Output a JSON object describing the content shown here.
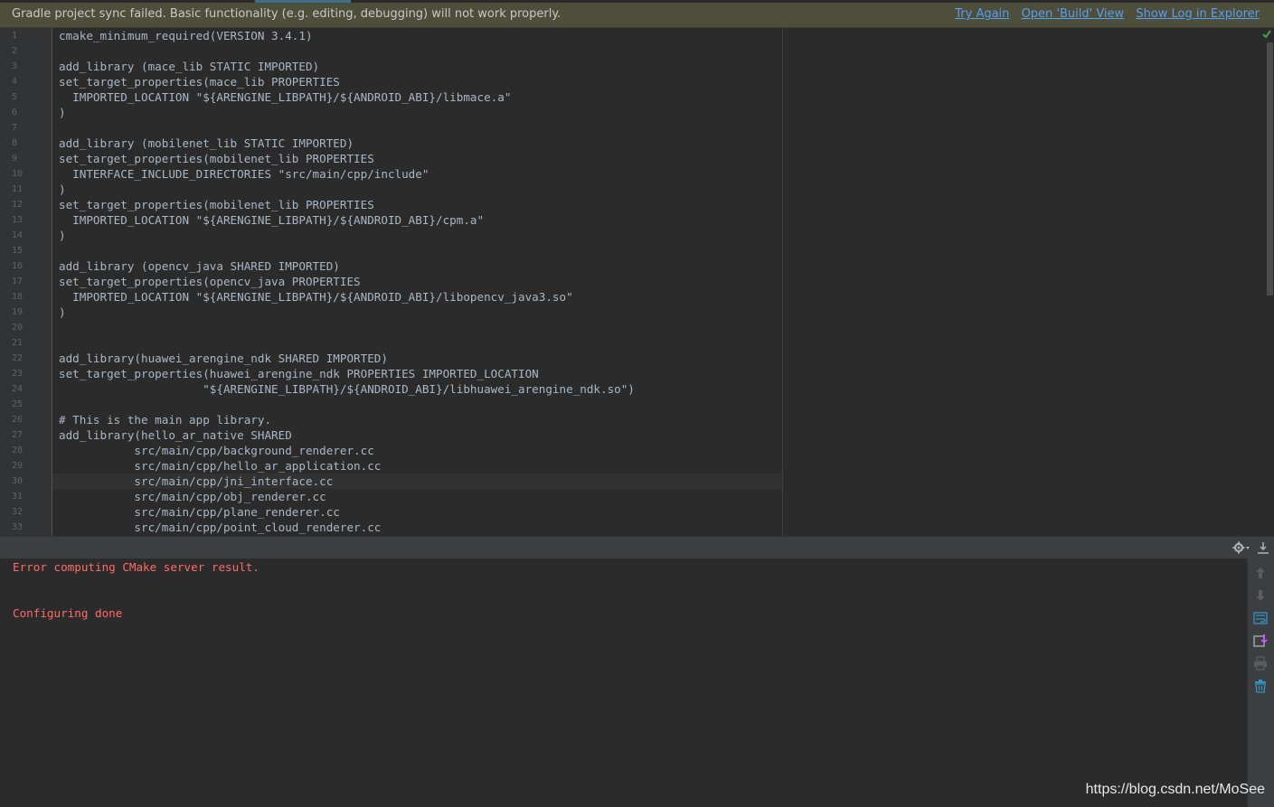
{
  "banner": {
    "message": "Gradle project sync failed. Basic functionality (e.g. editing, debugging) will not work properly.",
    "links": [
      "Try Again",
      "Open 'Build' View",
      "Show Log in Explorer"
    ]
  },
  "editor": {
    "highlighted_line": 30,
    "lines": [
      {
        "n": "1",
        "t": "cmake_minimum_required(VERSION 3.4.1)"
      },
      {
        "n": "2",
        "t": ""
      },
      {
        "n": "3",
        "t": "add_library (mace_lib STATIC IMPORTED)"
      },
      {
        "n": "4",
        "t": "set_target_properties(mace_lib PROPERTIES"
      },
      {
        "n": "5",
        "t": "  IMPORTED_LOCATION \"${ARENGINE_LIBPATH}/${ANDROID_ABI}/libmace.a\""
      },
      {
        "n": "6",
        "t": ")"
      },
      {
        "n": "7",
        "t": ""
      },
      {
        "n": "8",
        "t": "add_library (mobilenet_lib STATIC IMPORTED)"
      },
      {
        "n": "9",
        "t": "set_target_properties(mobilenet_lib PROPERTIES"
      },
      {
        "n": "10",
        "t": "  INTERFACE_INCLUDE_DIRECTORIES \"src/main/cpp/include\""
      },
      {
        "n": "11",
        "t": ")"
      },
      {
        "n": "12",
        "t": "set_target_properties(mobilenet_lib PROPERTIES"
      },
      {
        "n": "13",
        "t": "  IMPORTED_LOCATION \"${ARENGINE_LIBPATH}/${ANDROID_ABI}/cpm.a\""
      },
      {
        "n": "14",
        "t": ")"
      },
      {
        "n": "15",
        "t": ""
      },
      {
        "n": "16",
        "t": "add_library (opencv_java SHARED IMPORTED)"
      },
      {
        "n": "17",
        "t": "set_target_properties(opencv_java PROPERTIES"
      },
      {
        "n": "18",
        "t": "  IMPORTED_LOCATION \"${ARENGINE_LIBPATH}/${ANDROID_ABI}/libopencv_java3.so\""
      },
      {
        "n": "19",
        "t": ")"
      },
      {
        "n": "20",
        "t": ""
      },
      {
        "n": "21",
        "t": ""
      },
      {
        "n": "22",
        "t": "add_library(huawei_arengine_ndk SHARED IMPORTED)"
      },
      {
        "n": "23",
        "t": "set_target_properties(huawei_arengine_ndk PROPERTIES IMPORTED_LOCATION"
      },
      {
        "n": "24",
        "t": "                     \"${ARENGINE_LIBPATH}/${ANDROID_ABI}/libhuawei_arengine_ndk.so\")"
      },
      {
        "n": "25",
        "t": ""
      },
      {
        "n": "26",
        "t": "# This is the main app library."
      },
      {
        "n": "27",
        "t": "add_library(hello_ar_native SHARED"
      },
      {
        "n": "28",
        "t": "           src/main/cpp/background_renderer.cc"
      },
      {
        "n": "29",
        "t": "           src/main/cpp/hello_ar_application.cc"
      },
      {
        "n": "30",
        "t": "           src/main/cpp/jni_interface.cc"
      },
      {
        "n": "31",
        "t": "           src/main/cpp/obj_renderer.cc"
      },
      {
        "n": "32",
        "t": "           src/main/cpp/plane_renderer.cc"
      },
      {
        "n": "33",
        "t": "           src/main/cpp/point_cloud_renderer.cc"
      }
    ]
  },
  "console": {
    "lines": [
      "Error computing CMake server result.",
      "",
      "",
      "Configuring done"
    ]
  },
  "icons": {
    "inspection": "check-icon",
    "settings": "gear-icon",
    "hide": "hide-icon",
    "side": [
      "up-arrow-icon",
      "down-arrow-icon",
      "soft-wrap-icon",
      "scroll-to-end-icon",
      "print-icon",
      "trash-icon"
    ]
  },
  "watermark": "https://blog.csdn.net/MoSee",
  "colors": {
    "banner_bg": "#4d4f3a",
    "link": "#589df6",
    "error_text": "#ff6b68",
    "code_text": "#a9b7c6"
  }
}
